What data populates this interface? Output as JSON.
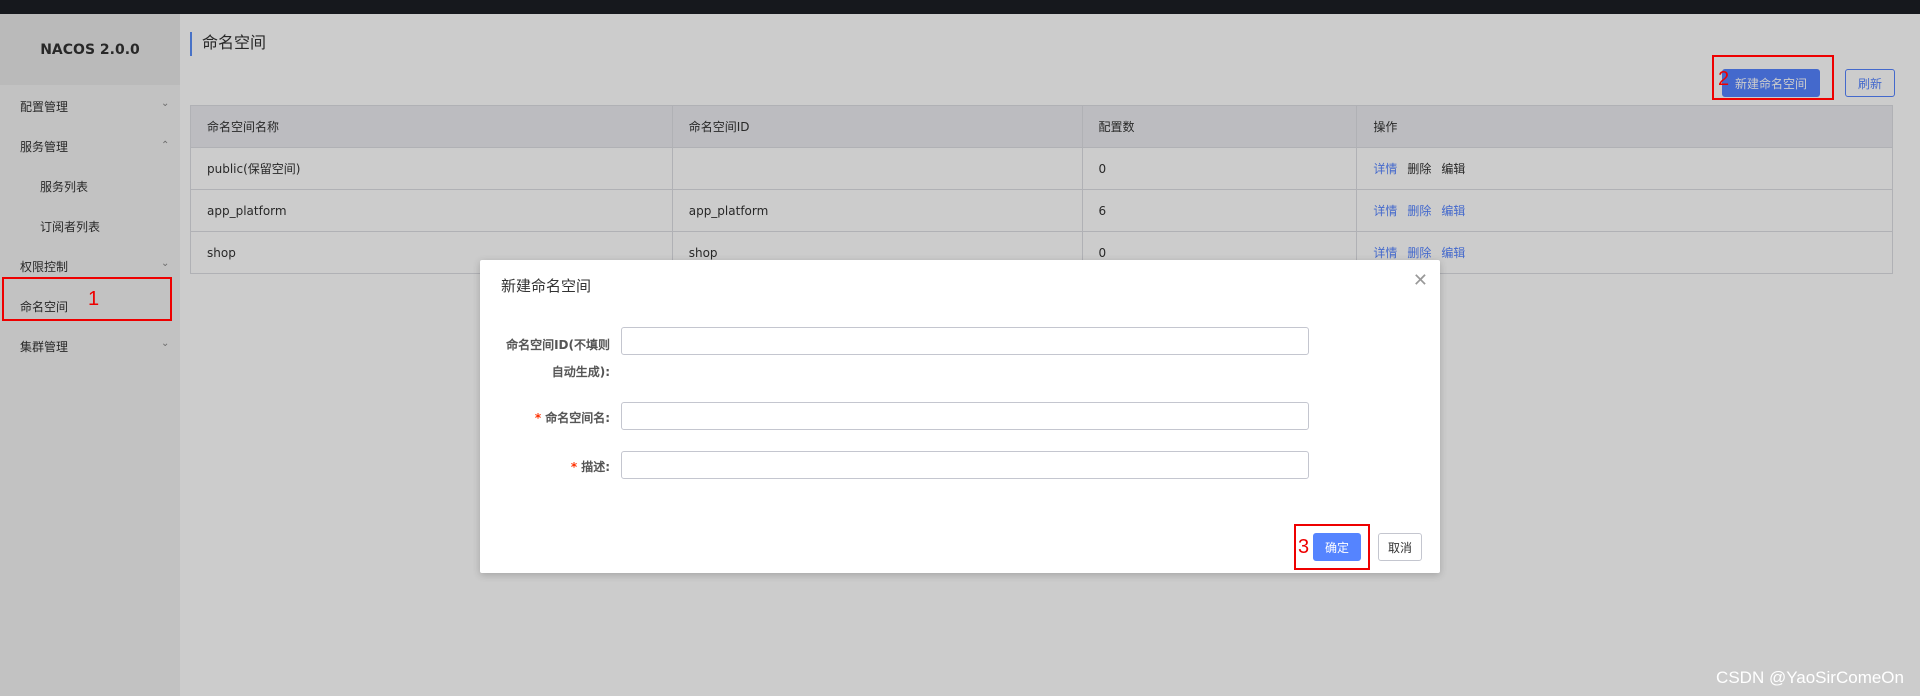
{
  "app": {
    "brand": "NACOS 2.0.0"
  },
  "sidebar": {
    "items": [
      {
        "label": "配置管理"
      },
      {
        "label": "服务管理"
      },
      {
        "label": "服务列表"
      },
      {
        "label": "订阅者列表"
      },
      {
        "label": "权限控制"
      },
      {
        "label": "命名空间"
      },
      {
        "label": "集群管理"
      }
    ]
  },
  "page": {
    "title": "命名空间",
    "new_button": "新建命名空间",
    "refresh_button": "刷新"
  },
  "table": {
    "headers": [
      "命名空间名称",
      "命名空间ID",
      "配置数",
      "操作"
    ],
    "rows": [
      {
        "name": "public(保留空间)",
        "id": "",
        "count": "0"
      },
      {
        "name": "app_platform",
        "id": "app_platform",
        "count": "6"
      },
      {
        "name": "shop",
        "id": "shop",
        "count": "0"
      }
    ],
    "ops": {
      "detail": "详情",
      "delete": "删除",
      "edit": "编辑"
    }
  },
  "dialog": {
    "title": "新建命名空间",
    "field_id_label_line1": "命名空间ID(不填则",
    "field_id_label_line2": "自动生成):",
    "field_name_label": "命名空间名:",
    "field_desc_label": "描述:",
    "required_mark": "*",
    "confirm_button": "确定",
    "cancel_button": "取消"
  },
  "annotations": [
    "1",
    "2",
    "3"
  ],
  "watermark": "CSDN @YaoSirComeOn",
  "colors": {
    "accent": "#5584ff",
    "highlight": "#ee0000"
  }
}
